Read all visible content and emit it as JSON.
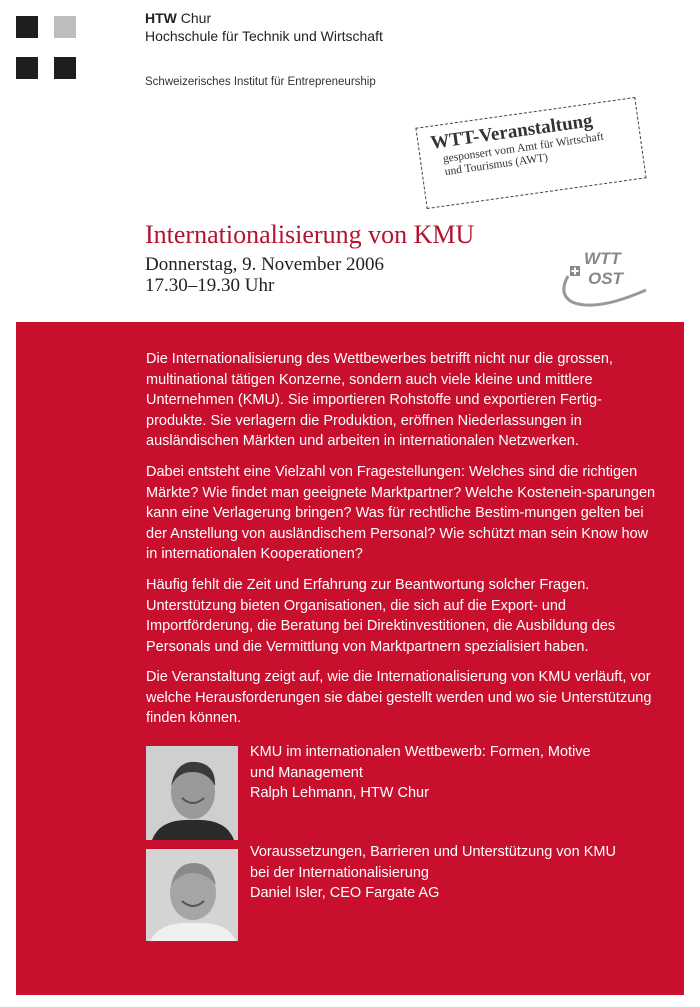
{
  "header": {
    "org_short": "HTW",
    "org_city": " Chur",
    "org_full": "Hochschule für Technik und Wirtschaft",
    "institute": "Schweizerisches Institut für Entrepreneurship"
  },
  "stamp": {
    "title": "WTT-Veranstaltung",
    "line1": "gesponsert vom Amt für Wirtschaft",
    "line2": "und Tourismus (AWT)"
  },
  "event": {
    "title": "Internationalisierung von KMU",
    "date": "Donnerstag, 9. November 2006",
    "time": "17.30–19.30 Uhr"
  },
  "wtt_logo": {
    "top": "WTT",
    "bottom": "OST"
  },
  "body": {
    "paragraphs": [
      "Die Internationalisierung des Wettbewerbes betrifft nicht nur die grossen, multinational tätigen Konzerne, sondern auch viele kleine und mittlere Unternehmen (KMU). Sie importieren Rohstoffe und exportieren Fertig-produkte. Sie verlagern die Produktion, eröffnen Niederlassungen in ausländischen Märkten und arbeiten in internationalen Netzwerken.",
      "Dabei entsteht eine Vielzahl von Fragestellungen: Welches sind die richtigen Märkte? Wie findet man geeignete Marktpartner? Welche Kostenein-sparungen kann eine Verlagerung bringen? Was für rechtliche Bestim-mungen gelten bei der Anstellung von ausländischem Personal? Wie schützt man sein Know how in internationalen Kooperationen?",
      "Häufig fehlt die Zeit und Erfahrung zur Beantwortung solcher Fragen. Unterstützung bieten Organisationen, die sich auf die Export- und Importförderung, die Beratung bei Direktinvestitionen, die Ausbildung des Personals und die Vermittlung von Marktpartnern spezialisiert haben.",
      "Die Veranstaltung zeigt auf, wie die Internationalisierung von KMU verläuft, vor welche Herausforderungen sie dabei gestellt werden und wo sie Unterstützung finden können."
    ]
  },
  "speakers": [
    {
      "topic_line1": "KMU im internationalen Wettbewerb: Formen, Motive",
      "topic_line2": "und Management",
      "name": "Ralph Lehmann, HTW Chur"
    },
    {
      "topic_line1": "Voraussetzungen, Barrieren und Unterstützung von KMU",
      "topic_line2": "bei der Internationalisierung",
      "name": "Daniel Isler, CEO Fargate AG"
    }
  ],
  "colors": {
    "accent": "#c8102e",
    "title": "#b41330"
  }
}
